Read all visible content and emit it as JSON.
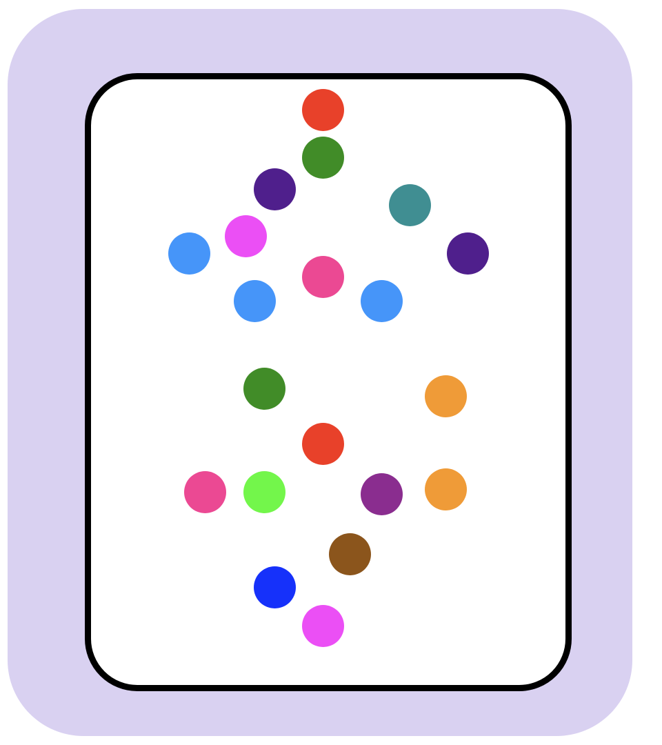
{
  "board": {
    "outer_color": "#d9d1f1",
    "card_border_color": "#000000",
    "card_background": "#ffffff"
  },
  "dots": [
    {
      "color": "#e8412a"
    },
    {
      "color": "#418c28"
    },
    {
      "color": "#4f1f8c"
    },
    {
      "color": "#408e92"
    },
    {
      "color": "#eb4ff5"
    },
    {
      "color": "#4695f9"
    },
    {
      "color": "#4f1f8c"
    },
    {
      "color": "#eb4993"
    },
    {
      "color": "#4695f9"
    },
    {
      "color": "#4695f9"
    },
    {
      "color": "#418c28"
    },
    {
      "color": "#ef9b38"
    },
    {
      "color": "#e8412a"
    },
    {
      "color": "#eb4993"
    },
    {
      "color": "#73f64b"
    },
    {
      "color": "#8a2d8f"
    },
    {
      "color": "#ef9b38"
    },
    {
      "color": "#8b551c"
    },
    {
      "color": "#1631fa"
    },
    {
      "color": "#eb4ff5"
    }
  ]
}
